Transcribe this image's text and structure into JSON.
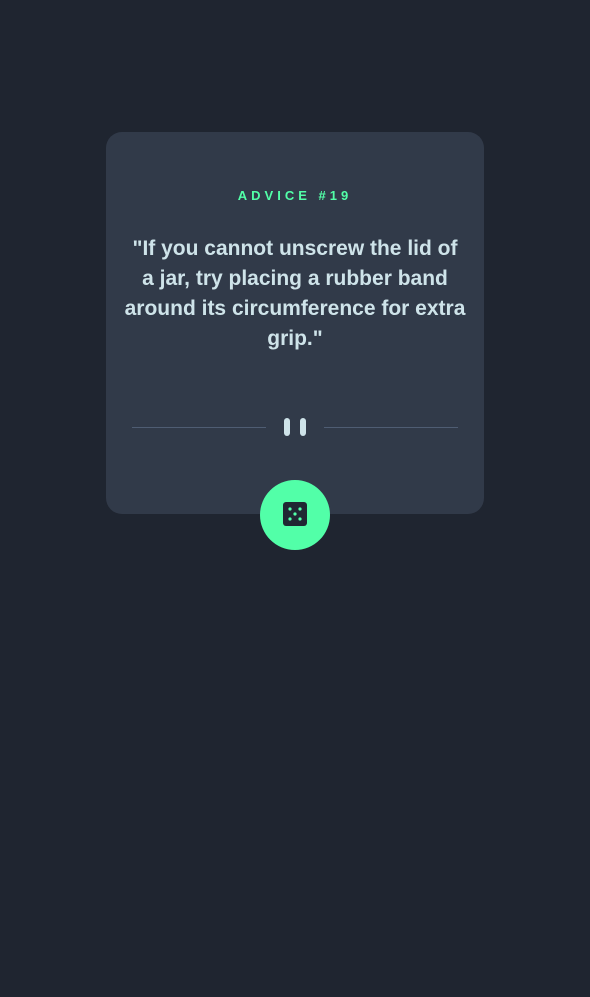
{
  "card": {
    "advice_id": "ADVICE #19",
    "quote": "\"If you cannot unscrew the lid of a jar, try placing a rubber band around its circumference for extra grip.\""
  },
  "icons": {
    "divider": "pause-icon",
    "button": "dice-icon"
  },
  "colors": {
    "background": "#1f2530",
    "card": "#313a49",
    "accent": "#52ffa8",
    "text": "#cee3e9",
    "divider": "#4f5d73"
  }
}
